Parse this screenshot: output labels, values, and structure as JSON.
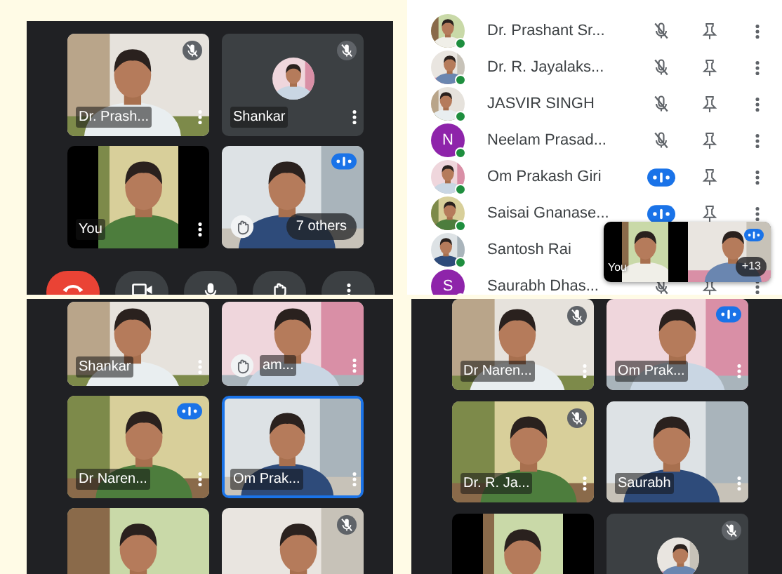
{
  "screens": [
    {
      "kind": "call",
      "tiles": [
        {
          "kind": "video",
          "name": "Dr. Prash...",
          "muted": true,
          "speaking": false,
          "hand_raised": false,
          "highlighted": false
        },
        {
          "kind": "avatar",
          "name": "Shankar",
          "muted": true,
          "speaking": false,
          "hand_raised": false,
          "highlighted": false
        },
        {
          "kind": "portrait",
          "name": "You",
          "muted": false,
          "speaking": false,
          "hand_raised": false,
          "highlighted": false
        },
        {
          "kind": "others",
          "name": "7 others",
          "muted": false,
          "speaking": true,
          "hand_raised": true,
          "highlighted": false
        }
      ],
      "controls": true
    },
    {
      "kind": "participants",
      "rows": [
        {
          "name": "Dr. Prashant Sr...",
          "muted": true,
          "speaking": false,
          "covered": false
        },
        {
          "name": "Dr. R. Jayalaks...",
          "muted": true,
          "speaking": false,
          "covered": false
        },
        {
          "name": "JASVIR SINGH",
          "muted": true,
          "speaking": false,
          "covered": false
        },
        {
          "name": "Neelam Prasad...",
          "avatar": {
            "kind": "letter",
            "letter": "N"
          },
          "muted": true,
          "speaking": false,
          "covered": false
        },
        {
          "name": "Om Prakash Giri",
          "muted": false,
          "speaking": true,
          "covered": false
        },
        {
          "name": "Saisai Gnanase...",
          "muted": false,
          "speaking": true,
          "covered": false
        },
        {
          "name": "Santosh Rai",
          "muted": false,
          "speaking": false,
          "covered": true
        },
        {
          "name": "Saurabh Dhas...",
          "avatar": {
            "kind": "letter",
            "letter": "S"
          },
          "muted": true,
          "speaking": false,
          "covered": false
        }
      ],
      "mini_window": {
        "self_name": "You",
        "speaking": true,
        "count": "+13"
      }
    },
    {
      "kind": "call",
      "tiles": [
        {
          "kind": "video",
          "name": "Shankar",
          "muted": false,
          "speaking": false,
          "hand_raised": false,
          "highlighted": false
        },
        {
          "kind": "video",
          "name": "am...",
          "muted": false,
          "speaking": false,
          "hand_raised": true,
          "highlighted": false
        },
        {
          "kind": "video",
          "name": "Dr Naren...",
          "muted": false,
          "speaking": true,
          "hand_raised": false,
          "highlighted": false
        },
        {
          "kind": "video",
          "name": "Om Prak...",
          "muted": false,
          "speaking": false,
          "hand_raised": false,
          "highlighted": true
        },
        {
          "kind": "video",
          "muted": false,
          "speaking": false,
          "hand_raised": false,
          "highlighted": false
        },
        {
          "kind": "video",
          "muted": true,
          "speaking": false,
          "hand_raised": false,
          "highlighted": false
        }
      ],
      "controls": false
    },
    {
      "kind": "call",
      "tiles": [
        {
          "kind": "video",
          "name": "Dr Naren...",
          "muted": true,
          "speaking": false,
          "hand_raised": false,
          "highlighted": false
        },
        {
          "kind": "video",
          "name": "Om Prak...",
          "muted": false,
          "speaking": true,
          "hand_raised": false,
          "highlighted": false
        },
        {
          "kind": "video",
          "name": "Dr. R. Ja...",
          "muted": true,
          "speaking": false,
          "hand_raised": false,
          "highlighted": false
        },
        {
          "kind": "video",
          "name": "Saurabh",
          "muted": false,
          "speaking": false,
          "hand_raised": false,
          "highlighted": false
        },
        {
          "kind": "portrait",
          "muted": false,
          "speaking": false,
          "hand_raised": false,
          "highlighted": false
        },
        {
          "kind": "avatar",
          "muted": true,
          "speaking": false,
          "hand_raised": false,
          "highlighted": false
        }
      ],
      "controls": false
    }
  ]
}
